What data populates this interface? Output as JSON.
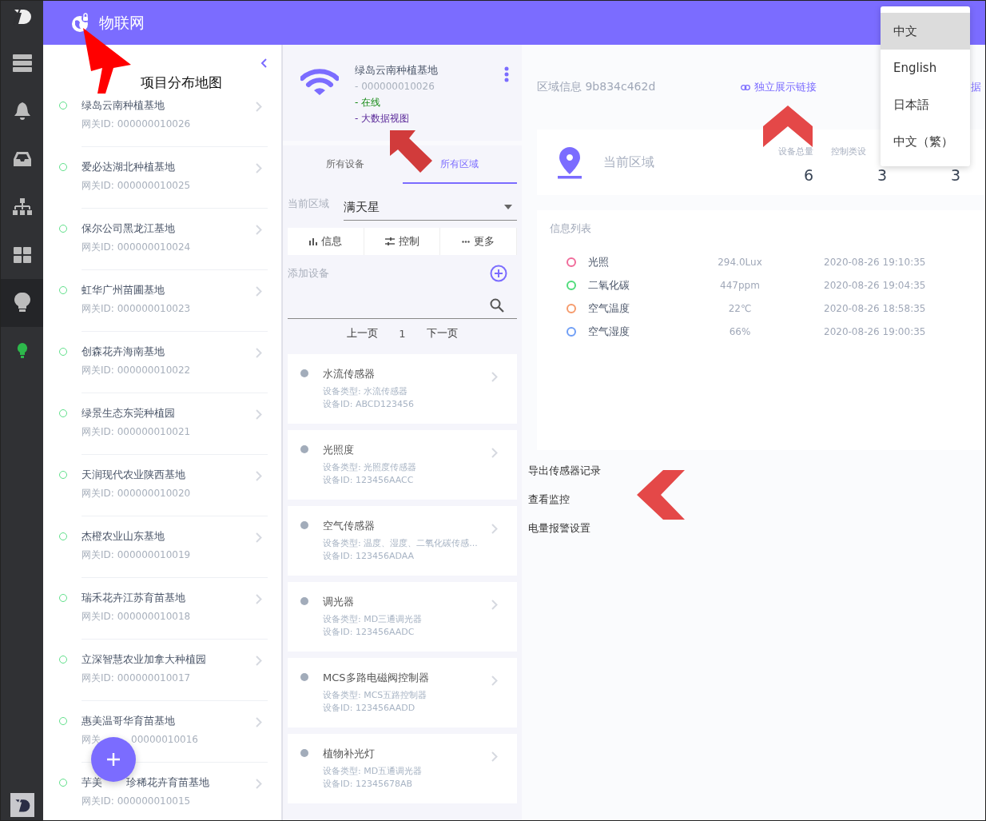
{
  "rail": {
    "items": [
      {
        "selected": false
      },
      {
        "selected": false
      },
      {
        "selected": false
      },
      {
        "selected": false
      },
      {
        "selected": false
      },
      {
        "selected": true
      },
      {
        "selected": false
      }
    ]
  },
  "header": {
    "title": "物联网"
  },
  "annotation": {
    "label": "项目分布地图"
  },
  "projects": [
    {
      "name": "绿岛云南种植基地",
      "gateway_id": "网关ID: 000000010026"
    },
    {
      "name": "爱必达湖北种植基地",
      "gateway_id": "网关ID: 000000010025"
    },
    {
      "name": "保尔公司黑龙江基地",
      "gateway_id": "网关ID: 000000010024"
    },
    {
      "name": "虹华广州苗圃基地",
      "gateway_id": "网关ID: 000000010023"
    },
    {
      "name": "创森花卉海南基地",
      "gateway_id": "网关ID: 000000010022"
    },
    {
      "name": "绿景生态东莞种植园",
      "gateway_id": "网关ID: 000000010021"
    },
    {
      "name": "天润现代农业陕西基地",
      "gateway_id": "网关ID: 000000010020"
    },
    {
      "name": "杰橙农业山东基地",
      "gateway_id": "网关ID: 000000010019"
    },
    {
      "name": "瑞禾花卉江苏育苗基地",
      "gateway_id": "网关ID: 000000010018"
    },
    {
      "name": "立深智慧农业加拿大种植园",
      "gateway_id": "网关ID: 000000010017"
    },
    {
      "name": "惠美温哥华育苗基地",
      "gateway_id_parts": [
        "网关",
        "00000010016"
      ]
    },
    {
      "name_parts": [
        "芋美",
        "珍稀花卉育苗基地"
      ],
      "gateway_id": "网关ID: 000000010015"
    }
  ],
  "gateway": {
    "name": "绿岛云南种植基地",
    "id": "- 000000010026",
    "status": "- 在线",
    "link": "- 大数据视图"
  },
  "tabs": [
    {
      "label": "所有设备",
      "selected": false
    },
    {
      "label": "所有区域",
      "selected": true
    }
  ],
  "region_select": {
    "label": "当前区域",
    "value": "满天星"
  },
  "action_buttons": [
    {
      "label": "信息"
    },
    {
      "label": "控制"
    },
    {
      "label": "更多"
    }
  ],
  "add_device": {
    "label": "添加设备"
  },
  "pagination": {
    "prev": "上一页",
    "page": "1",
    "next": "下一页"
  },
  "devices": [
    {
      "name": "水流传感器",
      "type": "设备类型: 水流传感器",
      "id": "设备ID: ABCD123456"
    },
    {
      "name": "光照度",
      "type": "设备类型: 光照度传感器",
      "id": "设备ID: 123456AACC"
    },
    {
      "name": "空气传感器",
      "type": "设备类型: 温度、湿度、二氧化碳传感...",
      "id": "设备ID: 123456ADAA"
    },
    {
      "name": "调光器",
      "type": "设备类型: MD三通调光器",
      "id": "设备ID: 123456AADC"
    },
    {
      "name": "MCS多路电磁阀控制器",
      "type": "设备类型: MCS五路控制器",
      "id": "设备ID: 123456AADD"
    },
    {
      "name": "植物补光灯",
      "type": "设备类型: MD五通调光器",
      "id": "设备ID: 12345678AB"
    }
  ],
  "region_info": {
    "title": "区域信息 9b834c462d",
    "link": "独立展示链接",
    "partial_link": "据"
  },
  "current_region": {
    "label": "当前区域",
    "stats": [
      {
        "label": "设备总量",
        "value": "6"
      },
      {
        "label": "控制类设",
        "value": "3"
      },
      {
        "value": "3"
      }
    ]
  },
  "info_list": {
    "title": "信息列表",
    "rows": [
      {
        "name": "光照",
        "value": "294.0Lux",
        "time": "2020-08-26 19:10:35",
        "color": "#f06b9a"
      },
      {
        "name": "二氧化碳",
        "value": "447ppm",
        "time": "2020-08-26 19:04:35",
        "color": "#4fdc7b"
      },
      {
        "name": "空气温度",
        "value": "22℃",
        "time": "2020-08-26 18:58:35",
        "color": "#f59a6b"
      },
      {
        "name": "空气湿度",
        "value": "66%",
        "time": "2020-08-26 19:00:35",
        "color": "#6f9ef5"
      }
    ]
  },
  "actions": [
    "导出传感器记录",
    "查看监控",
    "电量报警设置"
  ],
  "language_menu": [
    {
      "label": "中文",
      "selected": true
    },
    {
      "label": "English",
      "selected": false
    },
    {
      "label": "日本語",
      "selected": false
    },
    {
      "label": "中文（繁）",
      "selected": false
    }
  ]
}
